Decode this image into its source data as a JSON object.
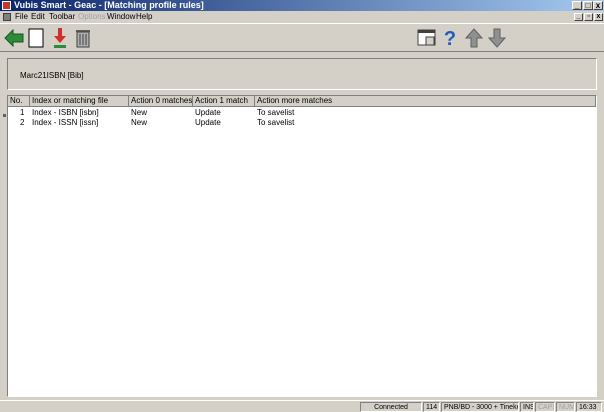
{
  "window": {
    "title": "Vubis Smart - Geac - [Matching profile rules]"
  },
  "menu": {
    "items": [
      "File",
      "Edit",
      "Toolbar",
      "Options",
      "Window",
      "Help"
    ]
  },
  "panel": {
    "label": "Marc21ISBN [Bib]"
  },
  "table": {
    "headers": [
      "No.",
      "Index or matching file",
      "Action 0 matches",
      "Action 1 match",
      "Action more matches"
    ],
    "rows": [
      [
        "1",
        "Index - ISBN [isbn]",
        "New",
        "Update",
        "To savelist"
      ],
      [
        "2",
        "Index - ISSN [issn]",
        "New",
        "Update",
        "To savelist"
      ]
    ]
  },
  "status": {
    "connection": "Connected",
    "count": "114",
    "location": "PNB/BD - 3000 + Tineke",
    "ins": "INS",
    "caps": "CAPS",
    "num": "NUM",
    "time": "16:33"
  },
  "icons": {
    "back": "back-arrow-icon",
    "new": "new-document-icon",
    "save": "download-arrow-icon",
    "delete": "trash-icon",
    "switch": "window-switch-icon",
    "help": "help-question-icon",
    "up": "arrow-up-icon",
    "down": "arrow-down-icon"
  },
  "colors": {
    "title_start": "#0a246a",
    "title_end": "#a6caf0",
    "back_arrow": "#2e8b3a",
    "save_arrow": "#d0302a",
    "help": "#1f5fb8"
  }
}
